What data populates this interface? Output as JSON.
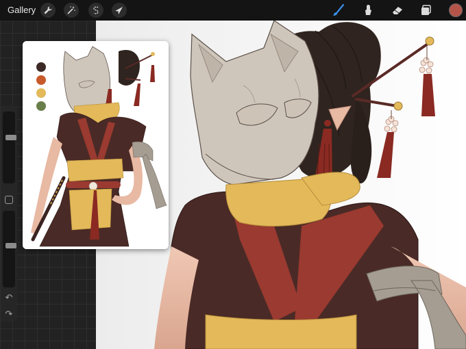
{
  "toolbar": {
    "gallery_label": "Gallery",
    "left_tools": [
      {
        "name": "actions",
        "icon": "wrench-icon"
      },
      {
        "name": "adjustments",
        "icon": "magic-wand-icon"
      },
      {
        "name": "selection",
        "icon": "selection-s-icon"
      },
      {
        "name": "transform",
        "icon": "arrow-cursor-icon"
      }
    ],
    "right_tools": [
      {
        "name": "brush",
        "icon": "brush-icon",
        "active": true
      },
      {
        "name": "smudge",
        "icon": "smudge-icon"
      },
      {
        "name": "eraser",
        "icon": "eraser-icon"
      },
      {
        "name": "layers",
        "icon": "layers-icon"
      }
    ],
    "current_color": "#b5554a",
    "accent_color": "#3a8fe8"
  },
  "sidebar": {
    "brush_size_level": 0.35,
    "opacity_level": 0.45,
    "undo_icon": "undo-icon",
    "redo_icon": "redo-icon"
  },
  "reference": {
    "palette": [
      "#3d2a26",
      "#c75a2a",
      "#e3b95a",
      "#6a7e4a"
    ]
  },
  "colors": {
    "mask": "#cfc6bb",
    "hair": "#2f241f",
    "tunic": "#4a2a26",
    "sash_red": "#9a3a30",
    "scarf_yellow": "#e3b95a",
    "skin": "#e8b9a3",
    "bandage": "#a59d91",
    "tassel": "#8a2a22"
  }
}
